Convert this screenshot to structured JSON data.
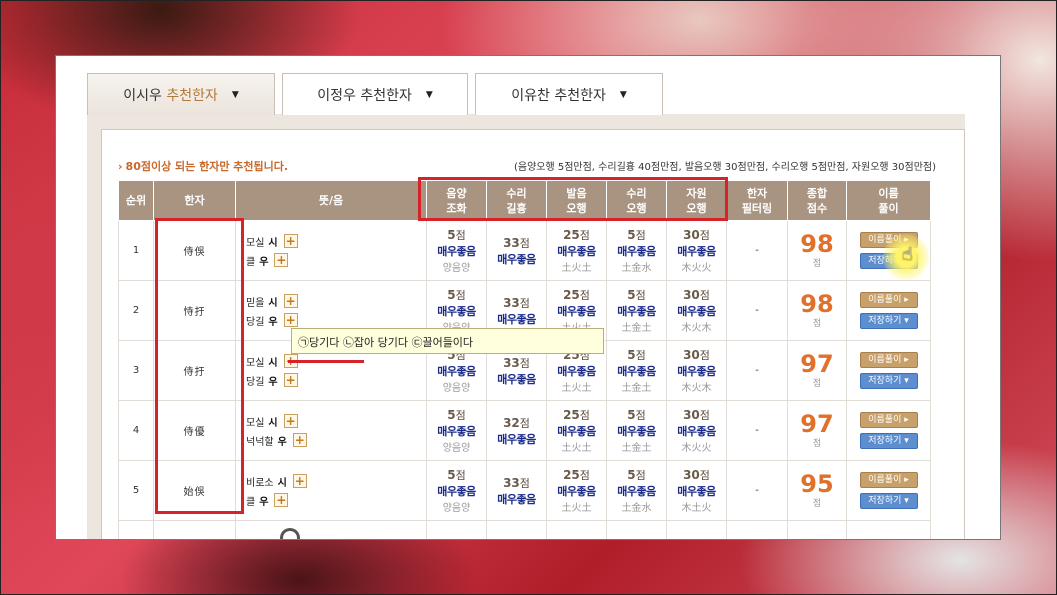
{
  "tabs": [
    {
      "name": "이시우",
      "suffix": "추천한자"
    },
    {
      "name": "이정우",
      "suffix": "추천한자"
    },
    {
      "name": "이유찬",
      "suffix": "추천한자"
    }
  ],
  "notice": "80점이상 되는 한자만 추천됩니다.",
  "scoring_prefix": "(음양오행 ",
  "scoring": [
    {
      "label": "음양오행",
      "points": "5점"
    },
    {
      "label": "수리길흉",
      "points": "40점"
    },
    {
      "label": "발음오행",
      "points": "30점"
    },
    {
      "label": "수리오행",
      "points": "5점"
    },
    {
      "label": "자원오행",
      "points": "30점"
    }
  ],
  "scoring_text": "(음양오행 5점만점, 수리길흉 40점만점, 발음오행 30점만점, 수리오행 5점만점, 자원오행 30점만점)",
  "headers": {
    "rank": "순위",
    "hanja": "한자",
    "meaning": "뜻/음",
    "c1a": "음양",
    "c1b": "조화",
    "c2a": "수리",
    "c2b": "길흉",
    "c3a": "발음",
    "c3b": "오행",
    "c4a": "수리",
    "c4b": "오행",
    "c5a": "자원",
    "c5b": "오행",
    "filter_a": "한자",
    "filter_b": "필터링",
    "total_a": "종합",
    "total_b": "점수",
    "name_a": "이름",
    "name_b": "풀이"
  },
  "rows": [
    {
      "rank": "1",
      "hanja": "侍俁",
      "m1w": "모실",
      "m1s": "시",
      "m2w": "클",
      "m2s": "우",
      "s": [
        [
          "5",
          "매우좋음",
          "양음양"
        ],
        [
          "33",
          "매우좋음",
          ""
        ],
        [
          "25",
          "매우좋음",
          "土火土"
        ],
        [
          "5",
          "매우좋음",
          "土金水"
        ],
        [
          "30",
          "매우좋음",
          "木火火"
        ]
      ],
      "filter": "-",
      "total": "98"
    },
    {
      "rank": "2",
      "hanja": "恃扜",
      "m1w": "믿을",
      "m1s": "시",
      "m2w": "당길",
      "m2s": "우",
      "s": [
        [
          "5",
          "매우좋음",
          "양음양"
        ],
        [
          "33",
          "매우좋음",
          ""
        ],
        [
          "25",
          "매우좋음",
          "土火土"
        ],
        [
          "5",
          "매우좋음",
          "土金土"
        ],
        [
          "30",
          "매우좋음",
          "木火木"
        ]
      ],
      "filter": "-",
      "total": "98"
    },
    {
      "rank": "3",
      "hanja": "侍扜",
      "m1w": "모실",
      "m1s": "시",
      "m2w": "당길",
      "m2s": "우",
      "s": [
        [
          "5",
          "매우좋음",
          "양음양"
        ],
        [
          "33",
          "매우좋음",
          ""
        ],
        [
          "25",
          "매우좋음",
          "土火土"
        ],
        [
          "5",
          "매우좋음",
          "土金土"
        ],
        [
          "30",
          "매우좋음",
          "木火木"
        ]
      ],
      "filter": "-",
      "total": "97"
    },
    {
      "rank": "4",
      "hanja": "侍優",
      "m1w": "모실",
      "m1s": "시",
      "m2w": "넉넉할",
      "m2s": "우",
      "s": [
        [
          "5",
          "매우좋음",
          "양음양"
        ],
        [
          "32",
          "매우좋음",
          ""
        ],
        [
          "25",
          "매우좋음",
          "土火土"
        ],
        [
          "5",
          "매우좋음",
          "土金土"
        ],
        [
          "30",
          "매우좋음",
          "木火火"
        ]
      ],
      "filter": "-",
      "total": "97"
    },
    {
      "rank": "5",
      "hanja": "始俁",
      "m1w": "비로소",
      "m1s": "시",
      "m2w": "클",
      "m2s": "우",
      "s": [
        [
          "5",
          "매우좋음",
          "양음양"
        ],
        [
          "33",
          "매우좋음",
          ""
        ],
        [
          "25",
          "매우좋음",
          "土火土"
        ],
        [
          "5",
          "매우좋음",
          "土金水"
        ],
        [
          "30",
          "매우좋음",
          "木土火"
        ]
      ],
      "filter": "-",
      "total": "95"
    }
  ],
  "point_unit": "점",
  "buttons": {
    "name": "이름풀이 ▸",
    "save": "저장하기 ▾"
  },
  "tooltip": "㉠당기다 ㉡잡아 당기다 ㉢끌어들이다",
  "colors": {
    "accent_orange": "#e0702a",
    "header_bg": "#a99482",
    "highlight_red": "#d8222a"
  }
}
